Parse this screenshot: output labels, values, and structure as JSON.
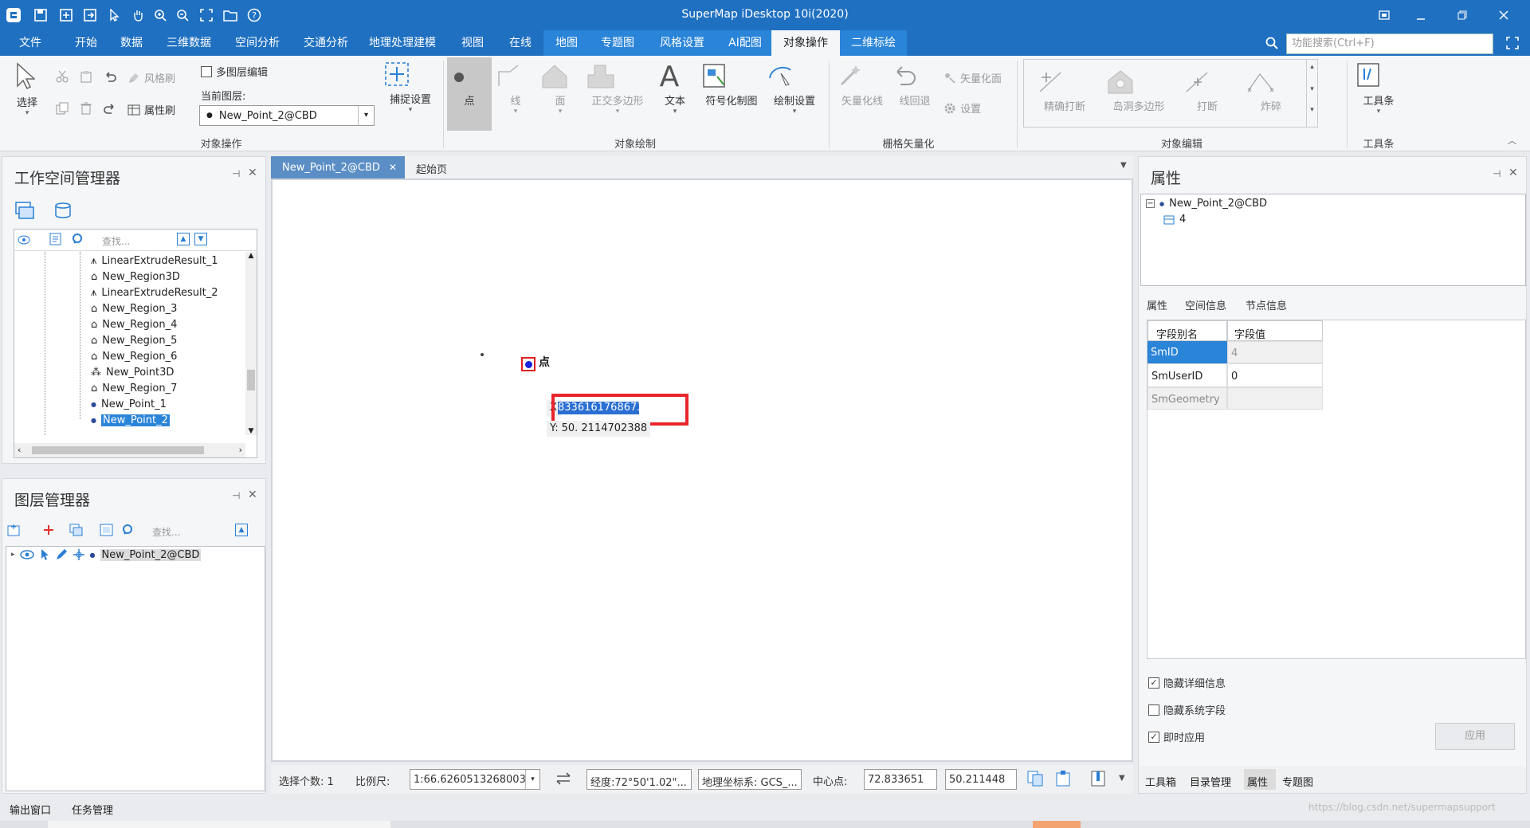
{
  "app": {
    "title": "SuperMap iDesktop 10i(2020)"
  },
  "menu": {
    "file": "文件",
    "start": "开始",
    "data": "数据",
    "data3d": "三维数据",
    "spatial": "空间分析",
    "traffic": "交通分析",
    "geoproc": "地理处理建模",
    "view": "视图",
    "online": "在线",
    "map": "地图",
    "thematic": "专题图",
    "style": "风格设置",
    "ai": "AI配图",
    "objop": "对象操作",
    "label3d": "二维标绘"
  },
  "search": {
    "placeholder": "功能搜索(Ctrl+F)"
  },
  "ribbon": {
    "select": "选择",
    "style_brush": "风格刷",
    "attr_brush": "属性刷",
    "multi_layer": "多图层编辑",
    "current_layer": "当前图层:",
    "layer_value": "New_Point_2@CBD",
    "snap": "捕捉设置",
    "point": "点",
    "line": "线",
    "face": "面",
    "ortho": "正交多边形",
    "text": "文本",
    "symbol": "符号化制图",
    "draw_settings": "绘制设置",
    "vectorize_line": "矢量化线",
    "line_back": "线回退",
    "vectorize_face": "矢量化面",
    "settings": "设置",
    "precise_break": "精确打断",
    "island": "岛洞多边形",
    "break": "打断",
    "explode": "炸碎",
    "toolbar": "工具条",
    "groups": {
      "objop": "对象操作",
      "draw": "对象绘制",
      "raster": "栅格矢量化",
      "edit": "对象编辑",
      "toolbar": "工具条"
    }
  },
  "workspace": {
    "title": "工作空间管理器",
    "search_placeholder": "查找...",
    "items": [
      "LinearExtrudeResult_1",
      "New_Region3D",
      "LinearExtrudeResult_2",
      "New_Region_3",
      "New_Region_4",
      "New_Region_5",
      "New_Region_6",
      "New_Point3D",
      "New_Region_7",
      "New_Point_1",
      "New_Point_2"
    ]
  },
  "layers": {
    "title": "图层管理器",
    "search_placeholder": "查找...",
    "layer": "New_Point_2@CBD"
  },
  "doc": {
    "tab_active": "New_Point_2@CBD",
    "tab_start": "起始页"
  },
  "map": {
    "label": "点",
    "x_label": "X",
    "x_value": "8336161768673",
    "y_label": "Y:",
    "y_value": "50. 2114702388"
  },
  "status": {
    "select_count": "选择个数: 1",
    "scale_label": "比例尺:",
    "scale_value": "1:66.6260513268003",
    "lonlat": "经度:72°50'1.02\"...",
    "crs": "地理坐标系: GCS_...",
    "center_label": "中心点:",
    "center_x": "72.833651",
    "center_y": "50.211448"
  },
  "props": {
    "title": "属性",
    "tree_root": "New_Point_2@CBD",
    "tree_child": "4",
    "tabs": {
      "attr": "属性",
      "spatial": "空间信息",
      "node": "节点信息"
    },
    "table": {
      "col_name": "字段别名",
      "col_value": "字段值",
      "rows": [
        {
          "name": "SmID",
          "value": "4"
        },
        {
          "name": "SmUserID",
          "value": "0"
        },
        {
          "name": "SmGeometry",
          "value": ""
        }
      ]
    },
    "hide_detail": "隐藏详细信息",
    "hide_sys": "隐藏系统字段",
    "instant": "即时应用",
    "apply": "应用",
    "bottom_tabs": {
      "toolbox": "工具箱",
      "catalog": "目录管理",
      "attr": "属性",
      "thematic": "专题图"
    }
  },
  "bottom": {
    "output": "输出窗口",
    "tasks": "任务管理"
  },
  "watermark": "https://blog.csdn.net/supermapsupport"
}
